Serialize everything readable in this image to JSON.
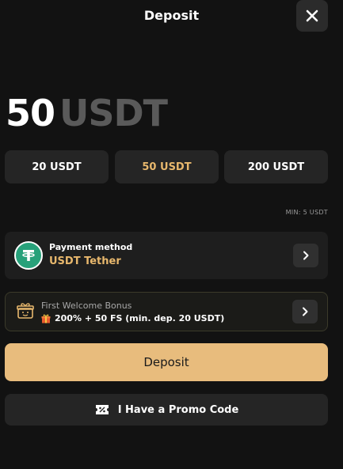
{
  "header": {
    "title": "Deposit"
  },
  "amount": {
    "value": "50",
    "currency": "USDT"
  },
  "presets": [
    {
      "label": "20 USDT",
      "active": false
    },
    {
      "label": "50 USDT",
      "active": true
    },
    {
      "label": "200 USDT",
      "active": false
    }
  ],
  "min_text": "MIN: 5 USDT",
  "payment": {
    "label": "Payment method",
    "value": "USDT Tether",
    "icon": "tether-icon"
  },
  "bonus": {
    "title": "First Welcome Bonus",
    "text": "200% + 50 FS (min. dep. 20 USDT)",
    "icon": "gift-icon"
  },
  "deposit_button": {
    "label": "Deposit"
  },
  "promo_button": {
    "label": "I Have a Promo Code",
    "icon": "promo-ticket-icon"
  },
  "colors": {
    "accent": "#e8b86d",
    "button": "#e8bc7d",
    "background": "#121212",
    "tether": "#27a17a"
  }
}
